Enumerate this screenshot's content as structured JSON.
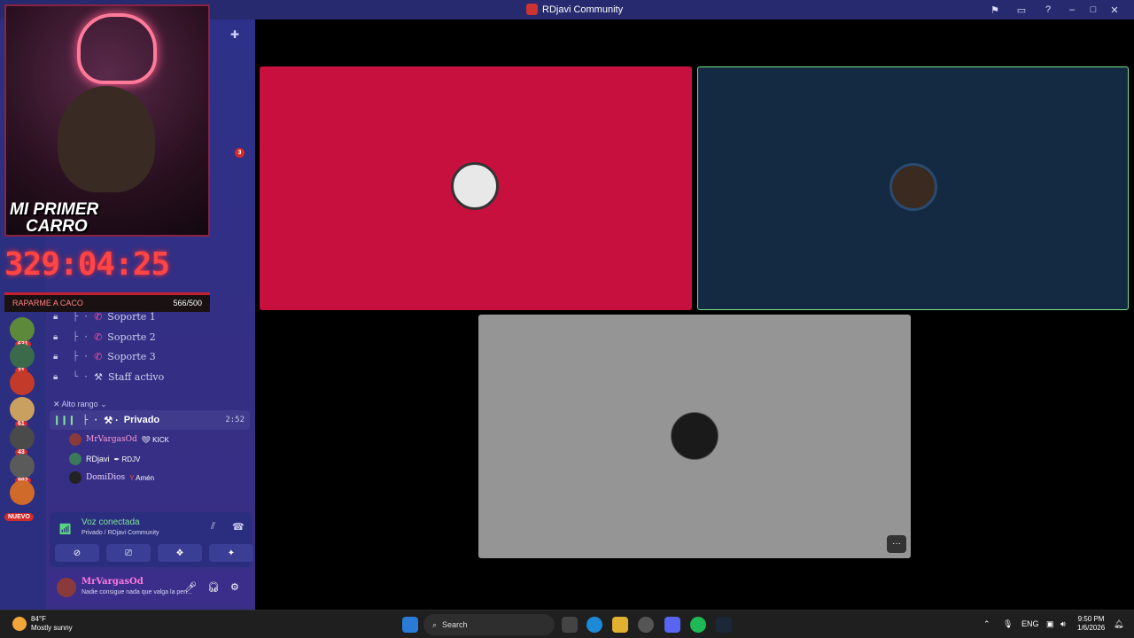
{
  "window": {
    "title": "RDjavi Community"
  },
  "overlay": {
    "caption_line1": "MI PRIMER",
    "caption_line2": "CARRO",
    "timer": "329:04:25",
    "goal_label": "RAPARME A CACO",
    "goal_value": "566/500",
    "goal_progress": 1.0
  },
  "rail": {
    "servers": [
      {
        "count": "631",
        "color": "#5d8a3a"
      },
      {
        "count": "21",
        "color": "#3a6a4a"
      },
      {
        "count": "",
        "color": "#c43a2a"
      },
      {
        "count": "61",
        "color": "#caa060"
      },
      {
        "count": "43",
        "color": "#4a4a4a"
      },
      {
        "count": "992",
        "color": "#5a5a5a"
      },
      {
        "count": "",
        "color": "#d06a2a"
      }
    ],
    "nuevo_label": "NUEVO"
  },
  "sidebar": {
    "unread_badge": "3",
    "channels": [
      {
        "label": "Soporte 1"
      },
      {
        "label": "Soporte 2"
      },
      {
        "label": "Soporte 3"
      },
      {
        "label": "Staff activo"
      }
    ],
    "category": "Alto rango",
    "active_channel": {
      "label": "Privado",
      "time": "2:52"
    },
    "members": [
      {
        "name": "MrVargasOd",
        "tag": "KICK",
        "color": "#8a3a3a"
      },
      {
        "name": "RDjavi",
        "tag": "RDJV",
        "color": "#3a7a5a"
      },
      {
        "name": "DomiDios",
        "tag": "Amén",
        "color": "#222222"
      }
    ]
  },
  "voice": {
    "status": "Voz conectada",
    "location": "Privado / RDjavi Community"
  },
  "user": {
    "name": "MrVargasOd",
    "status": "Nadie consigue nada que valga la pen..."
  },
  "tiles": [
    {
      "color": "#c8103e"
    },
    {
      "color": "#142a42"
    },
    {
      "color": "#959595"
    }
  ],
  "taskbar": {
    "temp": "84°F",
    "weather": "Mostly sunny",
    "search_placeholder": "Search",
    "lang": "ENG",
    "time": "9:50 PM",
    "date": "1/6/2026"
  }
}
